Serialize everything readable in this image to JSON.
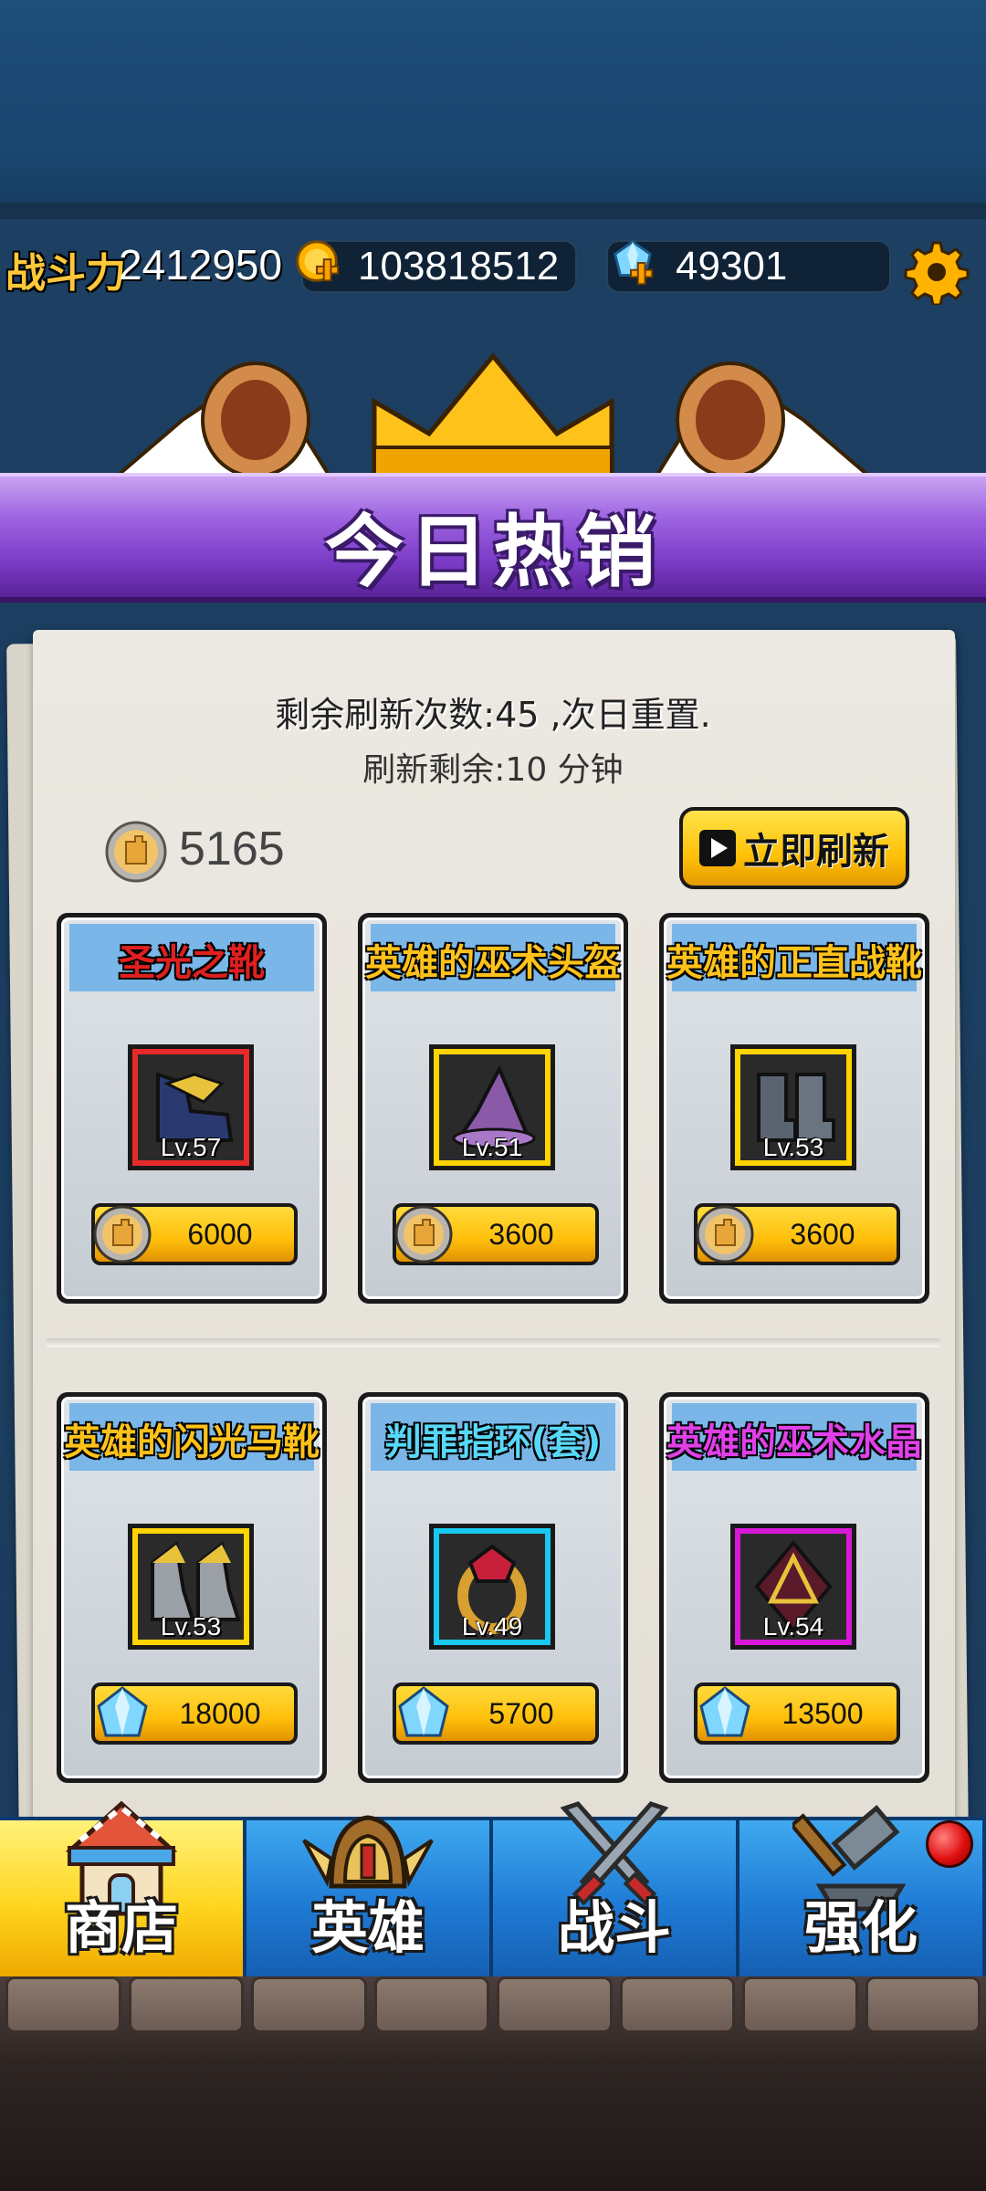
{
  "status": {
    "power_label": "战斗力",
    "power_value": "2412950",
    "gold": "103818512",
    "diamonds": "49301"
  },
  "banner": {
    "title": "今日热销"
  },
  "shop": {
    "refresh_count_text": "剩余刷新次数:45 ,次日重置.",
    "refresh_time_text": "刷新剩余:10 分钟",
    "token_count": "5165",
    "refresh_button_label": "立即刷新",
    "items": [
      {
        "name": "圣光之靴",
        "name_color": "#e02020",
        "level": "Lv.57",
        "price": "6000",
        "currency": "token",
        "frame_color": "#e82a2a",
        "icon": "boots-holy-icon"
      },
      {
        "name": "英雄的巫术头盔",
        "name_color": "#ffc21a",
        "level": "Lv.51",
        "price": "3600",
        "currency": "token",
        "frame_color": "#ffd400",
        "icon": "wizard-hat-icon"
      },
      {
        "name": "英雄的正直战靴",
        "name_color": "#ffc21a",
        "level": "Lv.53",
        "price": "3600",
        "currency": "token",
        "frame_color": "#ffd400",
        "icon": "iron-boots-icon"
      },
      {
        "name": "英雄的闪光马靴",
        "name_color": "#ffc21a",
        "level": "Lv.53",
        "price": "18000",
        "currency": "diamond",
        "frame_color": "#ffd400",
        "icon": "gold-boots-icon"
      },
      {
        "name": "判罪指环(套)",
        "name_color": "#58d8f8",
        "level": "Lv.49",
        "price": "5700",
        "currency": "diamond",
        "frame_color": "#18c8f0",
        "icon": "ruby-ring-icon"
      },
      {
        "name": "英雄的巫术水晶",
        "name_color": "#e040e8",
        "level": "Lv.54",
        "price": "13500",
        "currency": "diamond",
        "frame_color": "#d818d8",
        "icon": "magic-crystal-icon"
      }
    ]
  },
  "nav": {
    "tabs": [
      {
        "label": "商店",
        "icon": "shop-house-icon",
        "active": true
      },
      {
        "label": "英雄",
        "icon": "hero-helmet-icon",
        "active": false
      },
      {
        "label": "战斗",
        "icon": "crossed-swords-icon",
        "active": false
      },
      {
        "label": "强化",
        "icon": "anvil-hammer-icon",
        "active": false
      }
    ]
  }
}
